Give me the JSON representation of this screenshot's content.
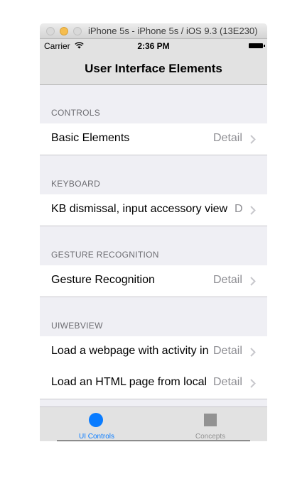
{
  "window": {
    "title": "iPhone 5s - iPhone 5s / iOS 9.3 (13E230)"
  },
  "status_bar": {
    "carrier": "Carrier",
    "time": "2:36 PM"
  },
  "nav": {
    "title": "User Interface Elements"
  },
  "sections": [
    {
      "header": "CONTROLS",
      "rows": [
        {
          "title": "Basic Elements",
          "detail": "Detail"
        }
      ]
    },
    {
      "header": "KEYBOARD",
      "rows": [
        {
          "title": "KB dismissal, input accessory view",
          "detail": "D"
        }
      ]
    },
    {
      "header": "GESTURE RECOGNITION",
      "rows": [
        {
          "title": "Gesture Recognition",
          "detail": "Detail"
        }
      ]
    },
    {
      "header": "UIWEBVIEW",
      "rows": [
        {
          "title": "Load a webpage with activity in",
          "detail": "Detail"
        },
        {
          "title": "Load an HTML page from local",
          "detail": "Detail"
        }
      ]
    }
  ],
  "tabs": [
    {
      "label": "UI Controls",
      "icon": "circle-icon",
      "selected": true,
      "color": "#0a7cff"
    },
    {
      "label": "Concepts",
      "icon": "square-icon",
      "selected": false,
      "color": "#929292"
    }
  ]
}
